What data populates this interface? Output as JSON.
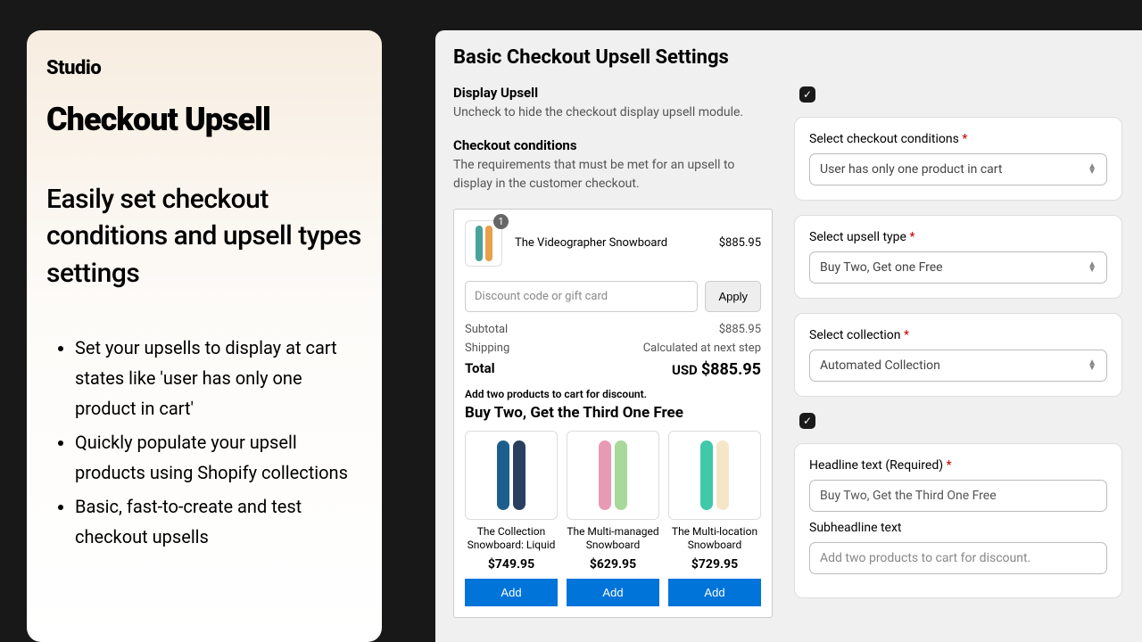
{
  "promo": {
    "logo": "Studio",
    "title": "Checkout Upsell",
    "lead": "Easily set checkout conditions and upsell types settings",
    "bullets": [
      "Set your upsells to display at cart states like 'user has only one product in cart'",
      "Quickly populate your upsell products using Shopify collections",
      "Basic, fast-to-create and test checkout upsells"
    ]
  },
  "app": {
    "title": "Basic Checkout Upsell Settings",
    "display_upsell": {
      "label": "Display Upsell",
      "desc": "Uncheck to hide the checkout display upsell module.",
      "checked": true
    },
    "conditions": {
      "label": "Checkout conditions",
      "desc": "The requirements that must be met for an upsell to display in the customer checkout."
    },
    "preview": {
      "badge": "1",
      "item_name": "The Videographer Snowboard",
      "item_price": "$885.95",
      "discount_placeholder": "Discount code or gift card",
      "apply": "Apply",
      "subtotal_label": "Subtotal",
      "subtotal": "$885.95",
      "shipping_label": "Shipping",
      "shipping": "Calculated at next step",
      "total_label": "Total",
      "currency": "USD",
      "total": "$885.95",
      "hint": "Add two products to cart for discount.",
      "promo_title": "Buy Two, Get the Third One Free",
      "products": [
        {
          "name": "The Collection Snowboard: Liquid",
          "price": "$749.95",
          "colors": [
            "#1d5f8c",
            "#2a3f5f"
          ]
        },
        {
          "name": "The Multi-managed Snowboard",
          "price": "$629.95",
          "colors": [
            "#e89ab5",
            "#a8d89a"
          ]
        },
        {
          "name": "The Multi-location Snowboard",
          "price": "$729.95",
          "colors": [
            "#3fc9a9",
            "#f5e6c8"
          ]
        }
      ],
      "add": "Add"
    },
    "form": {
      "checkout_cond": {
        "label": "Select checkout conditions",
        "value": "User has only one product in cart"
      },
      "upsell_type": {
        "label": "Select upsell type",
        "value": "Buy Two, Get one Free"
      },
      "collection": {
        "label": "Select collection",
        "value": "Automated Collection"
      },
      "extra_check": true,
      "headline": {
        "label": "Headline text (Required)",
        "value": "Buy Two, Get the Third One Free"
      },
      "subhead": {
        "label": "Subheadline text",
        "placeholder": "Add two products to cart for discount."
      }
    }
  }
}
